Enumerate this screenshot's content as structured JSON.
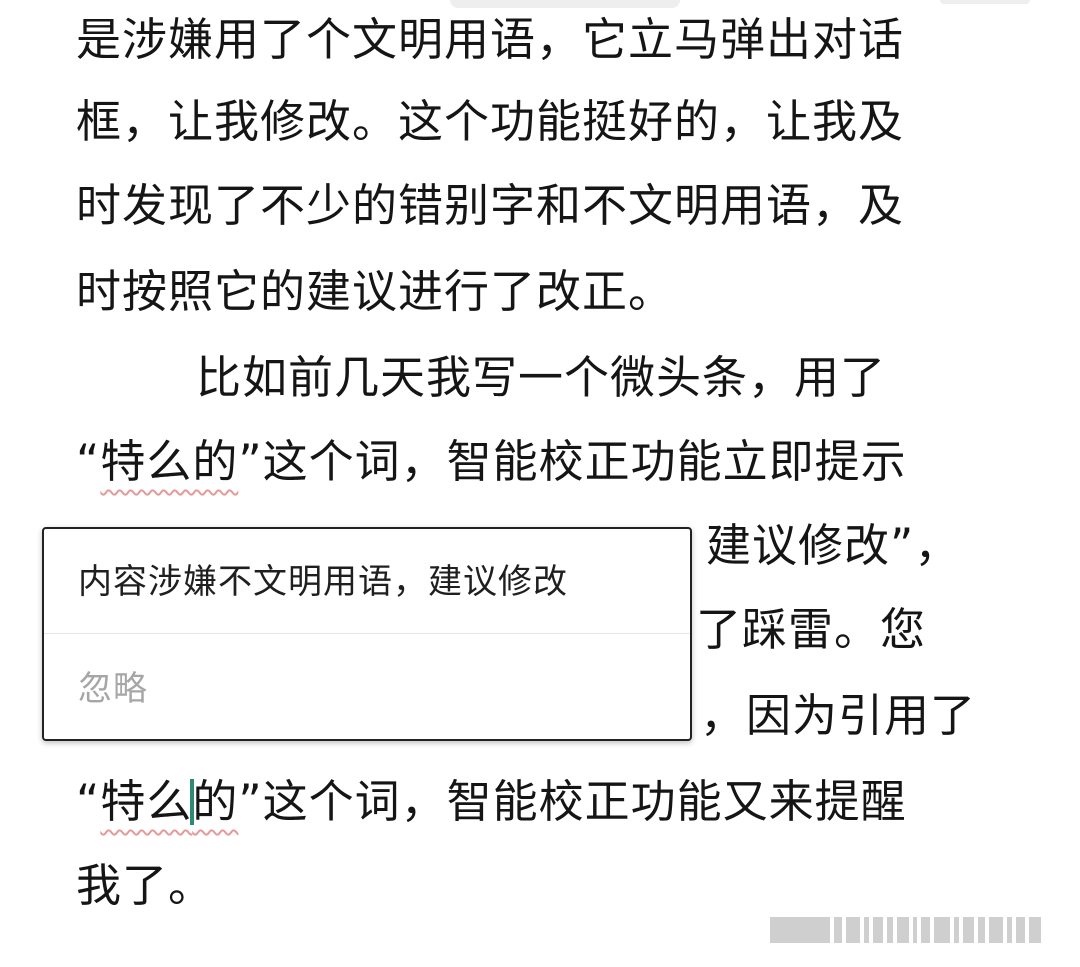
{
  "article": {
    "lines": [
      "是涉嫌用了个文明用语，它立马弹出对话",
      "框，让我修改。这个功能挺好的，让我及",
      "时发现了不少的错别字和不文明用语，及",
      "时按照它的建议进行了改正。",
      "比如前几天我写一个微头条，用了",
      "“特么的”这个词，智能校正功能立即提示",
      "我：“内容涉嫌不文明用语，建议修改”，",
      "　　　　　　　　　　　　　了踩雷。您",
      "　　　　　　　　　　　　，因为引用了",
      "“特么的”这个词，智能校正功能又来提醒",
      "我了。"
    ],
    "line6_prefix": "“",
    "line6_flag": "特么的",
    "line6_suffix": "”这个词，智能校正功能立即提示",
    "line7_visible": "建议修改”，",
    "line8_visible": "了踩雷。您",
    "line9_visible": "，因为引用了",
    "line10_prefix": "“",
    "line10_flag_a": "特么",
    "line10_flag_b": "的",
    "line10_suffix": "”这个词，智能校正功能又来提醒",
    "line11": "我了。"
  },
  "popup": {
    "message": "内容涉嫌不文明用语，建议修改",
    "ignore_label": "忽略"
  },
  "colors": {
    "caret": "#2f8a74",
    "squiggle": "#e59a9a",
    "ignore_text": "#a6a6a6"
  }
}
